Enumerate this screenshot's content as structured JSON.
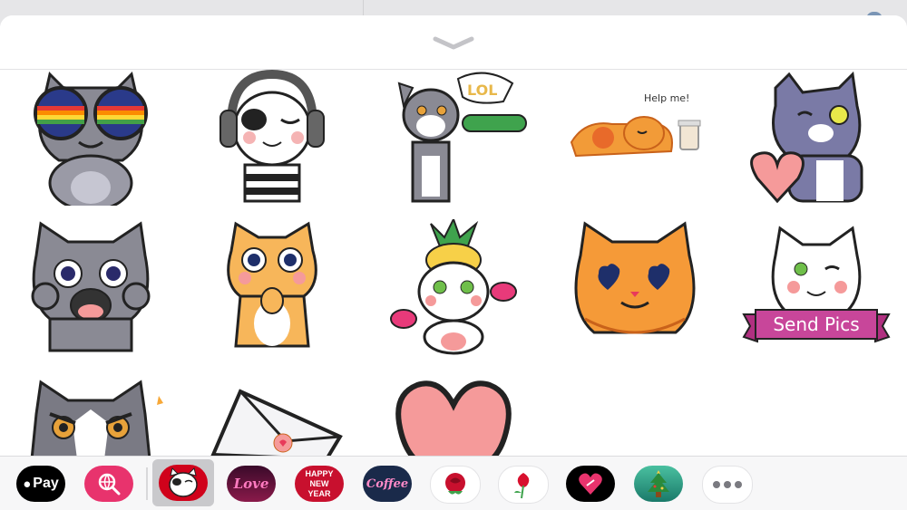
{
  "sticker_pack": {
    "stickers": [
      {
        "id": "rainbow-glasses-cat"
      },
      {
        "id": "headphones-cat"
      },
      {
        "id": "lol-cucumber-cat"
      },
      {
        "id": "help-me-coffee-cat",
        "text": "Help me!"
      },
      {
        "id": "heart-winking-cat"
      },
      {
        "id": "shocked-gray-cat"
      },
      {
        "id": "shy-orange-cat"
      },
      {
        "id": "pineapple-maracas-cat"
      },
      {
        "id": "heart-eyes-orange-cat"
      },
      {
        "id": "send-pics-cat",
        "text": "Send Pics"
      },
      {
        "id": "angry-gray-cat"
      },
      {
        "id": "love-letter-envelope"
      },
      {
        "id": "pink-heart"
      }
    ]
  },
  "drawer": {
    "apps": [
      {
        "name": "apple-pay",
        "label": "Pay",
        "color": "#000000"
      },
      {
        "name": "image-search",
        "color": "#e8336d"
      },
      {
        "name": "cat-stickers",
        "color": "#d0021b",
        "selected": true
      },
      {
        "name": "love-stickers",
        "label": "Love",
        "color": "#7a1040"
      },
      {
        "name": "happy-new-year",
        "label": "HAPPY NEW YEAR",
        "color": "#c8102e"
      },
      {
        "name": "coffee",
        "label": "Coffee",
        "color": "#1a2a4a"
      },
      {
        "name": "red-rose",
        "color": "#ffffff"
      },
      {
        "name": "rose-bud",
        "color": "#ffffff"
      },
      {
        "name": "heart-stickers",
        "color": "#000000"
      },
      {
        "name": "christmas-tree",
        "color": "#1a9a8a"
      },
      {
        "name": "more"
      }
    ]
  }
}
